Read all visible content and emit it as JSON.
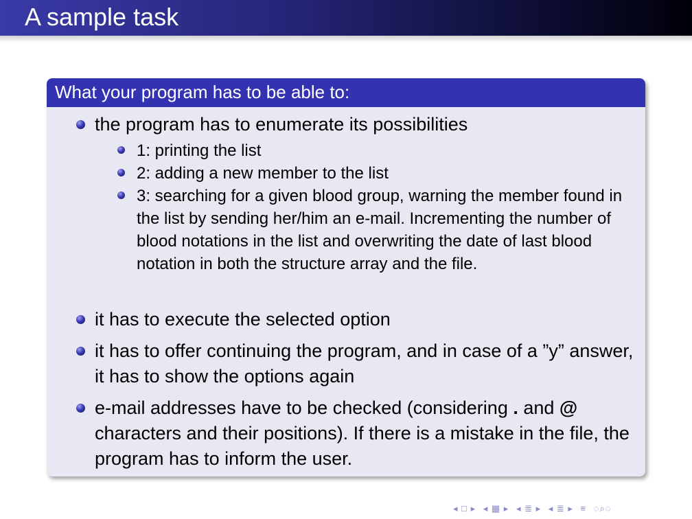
{
  "slide": {
    "title": "A sample task",
    "block_title": "What your program has to be able to:",
    "items": [
      "the program has to enumerate its possibilities",
      "it has to execute the selected option",
      "it has to offer continuing the program, and in case of a ”y” answer, it has to show the options again"
    ],
    "subitems": [
      "1: printing the list",
      "2: adding a new member to the list",
      "3: searching for a given blood group, warning the member found in the list by sending her/him an e-mail. Incrementing the number of blood notations in the list and overwriting the date of last blood notation in both the structure array and the file."
    ],
    "email_item": {
      "part1": "e-mail addresses have to be checked (considering ",
      "dot": ".",
      "and": " and ",
      "at": "@",
      "part2": " characters and their positions). If there is a mistake in the file, the program has to inform the user."
    }
  },
  "navigation": {
    "icons": [
      "first-frame-icon",
      "prev-frame-icon",
      "next-frame-icon",
      "prev-section-icon",
      "next-section-icon",
      "prev-subsection-icon",
      "next-subsection-icon",
      "align-icon",
      "search-icon"
    ]
  },
  "colors": {
    "title_bar": "#3a3aa8",
    "block_header": "#3333b2",
    "block_body": "#e8e8f2"
  }
}
